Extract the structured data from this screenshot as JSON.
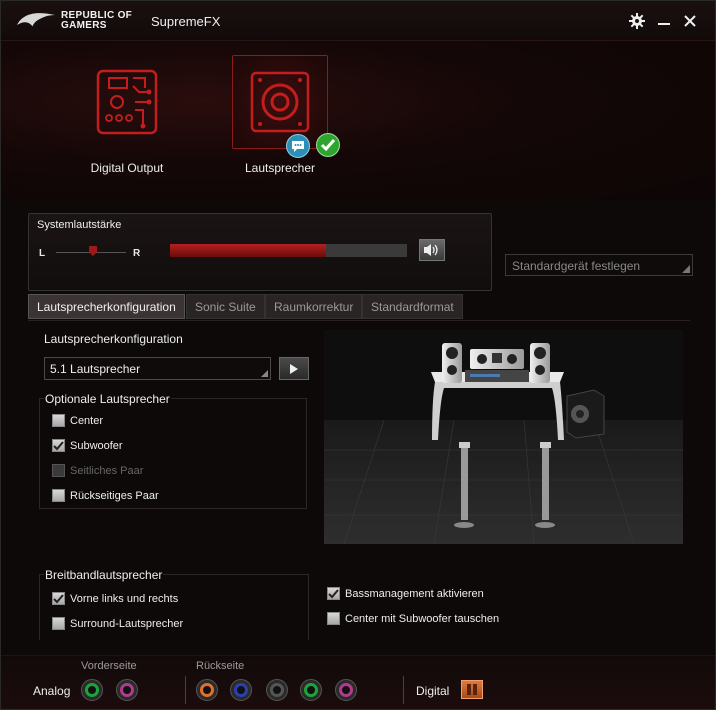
{
  "window": {
    "brand_line1": "REPUBLIC OF",
    "brand_line2": "GAMERS",
    "title": "SupremeFX"
  },
  "devices": [
    {
      "label": "Digital Output",
      "selected": false
    },
    {
      "label": "Lautsprecher",
      "selected": true
    }
  ],
  "volume": {
    "title": "Systemlautstärke",
    "left_label": "L",
    "right_label": "R",
    "level": 0.66
  },
  "default_device": {
    "label": "Standardgerät festlegen"
  },
  "tabs": [
    {
      "label": "Lautsprecherkonfiguration",
      "active": true
    },
    {
      "label": "Sonic Suite",
      "active": false
    },
    {
      "label": "Raumkorrektur",
      "active": false
    },
    {
      "label": "Standardformat",
      "active": false
    }
  ],
  "speaker_config": {
    "label": "Lautsprecherkonfiguration",
    "selected": "5.1 Lautsprecher"
  },
  "optional_speakers": {
    "title": "Optionale Lautsprecher",
    "items": [
      {
        "label": "Center",
        "checked": false,
        "disabled": false
      },
      {
        "label": "Subwoofer",
        "checked": true,
        "disabled": false
      },
      {
        "label": "Seitliches Paar",
        "checked": false,
        "disabled": true
      },
      {
        "label": "Rückseitiges Paar",
        "checked": false,
        "disabled": false
      }
    ]
  },
  "broadband": {
    "title": "Breitbandlautsprecher",
    "items": [
      {
        "label": "Vorne links und rechts",
        "checked": true
      },
      {
        "label": "Surround-Lautsprecher",
        "checked": false
      }
    ]
  },
  "bass": {
    "items": [
      {
        "label": "Bassmanagement aktivieren",
        "checked": true
      },
      {
        "label": "Center mit Subwoofer tauschen",
        "checked": false
      }
    ]
  },
  "jacks": {
    "analog_label": "Analog",
    "front_label": "Vorderseite",
    "rear_label": "Rückseite",
    "digital_label": "Digital",
    "front": [
      {
        "color": "#1aa53a"
      },
      {
        "color": "#b03a8c"
      }
    ],
    "rear": [
      {
        "color": "#e0702a"
      },
      {
        "color": "#2a3fb0"
      },
      {
        "color": "#555555"
      },
      {
        "color": "#1aa53a"
      },
      {
        "color": "#b03a8c"
      }
    ]
  },
  "colors": {
    "accent": "#b51d1d",
    "check_green": "#2ea52e"
  }
}
